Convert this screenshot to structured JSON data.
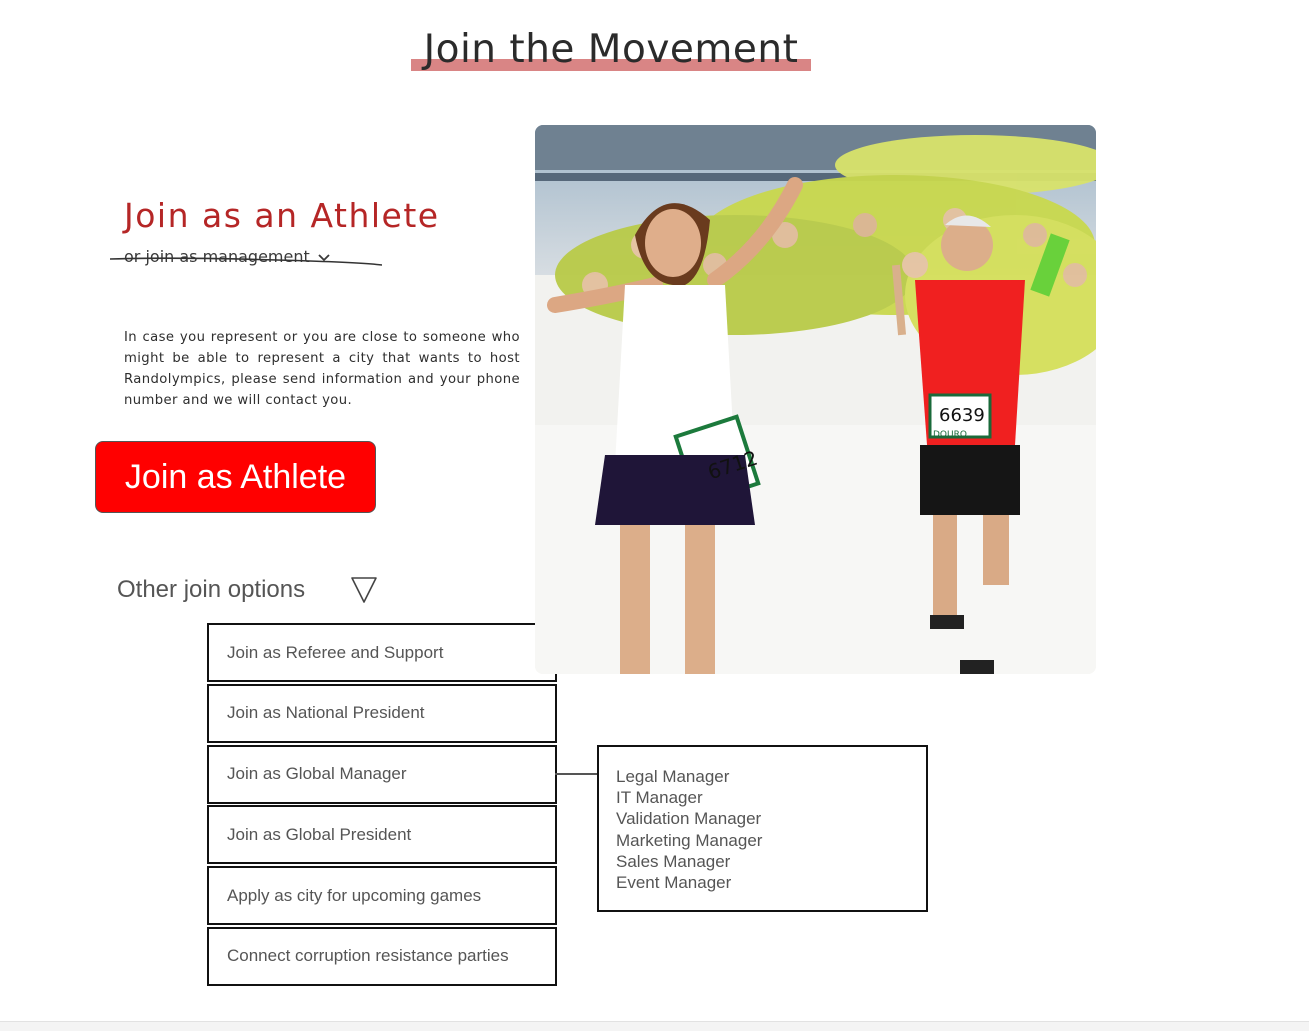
{
  "header": {
    "title": "Join the Movement"
  },
  "athlete": {
    "heading": "Join as an Athlete",
    "management_link": "or join as management",
    "intro": "In case you represent or you are close to someone who might be able to represent a city that wants to host Randolympics, please send information and your phone number and we will contact you.",
    "button_label": "Join as Athlete"
  },
  "other_options": {
    "label": "Other join options",
    "items": [
      "Join as Referee and Support",
      "Join as National President",
      "Join as Global Manager",
      "Join as Global President",
      "Apply as city for upcoming games",
      "Connect corruption resistance parties"
    ]
  },
  "global_manager_submenu": {
    "items": [
      "Legal Manager",
      "IT Manager",
      "Validation Manager",
      "Marketing Manager",
      "Sales Manager",
      "Event Manager"
    ]
  },
  "colors": {
    "accent": "#ff0000",
    "heading_red": "#b52626",
    "underline": "#d98585"
  },
  "hero_bibs": {
    "left": "6712",
    "right": "6639",
    "brand": "DOURO"
  }
}
